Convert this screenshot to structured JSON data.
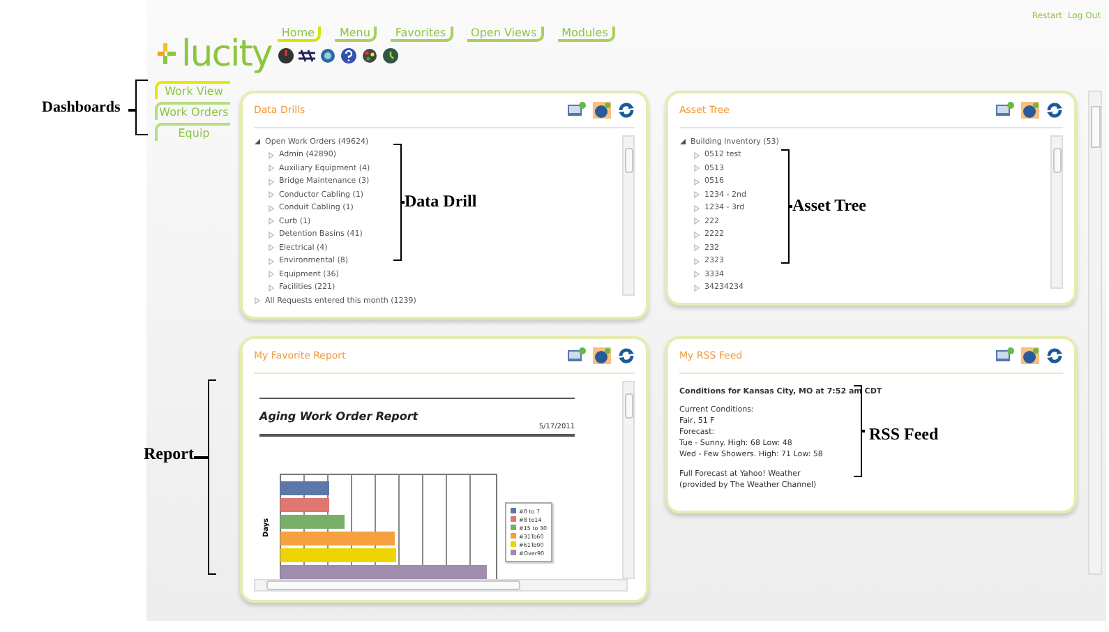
{
  "header": {
    "links": [
      {
        "label": "Restart"
      },
      {
        "label": "Log Out"
      }
    ],
    "logo": "lucity",
    "nav": [
      {
        "label": "Home",
        "selected": true
      },
      {
        "label": "Menu",
        "selected": false
      },
      {
        "label": "Favorites",
        "selected": false
      },
      {
        "label": "Open Views",
        "selected": false
      },
      {
        "label": "Modules",
        "selected": false
      }
    ]
  },
  "dashboards": [
    {
      "label": "Work View",
      "selected": true
    },
    {
      "label": "Work Orders",
      "selected": false
    },
    {
      "label": "Equip",
      "selected": false
    }
  ],
  "panels": [
    {
      "kind": "tree",
      "title": "Data Drills",
      "callout": "Data Drill",
      "tree": [
        {
          "label": "Open Work Orders (49624)",
          "expanded": true,
          "children": [
            {
              "label": "Admin (42890)",
              "expanded": false
            },
            {
              "label": "Auxiliary Equipment (4)",
              "expanded": false
            },
            {
              "label": "Bridge Maintenance (3)",
              "expanded": false
            },
            {
              "label": "Conductor Cabling (1)",
              "expanded": false
            },
            {
              "label": "Conduit Cabling (1)",
              "expanded": false
            },
            {
              "label": "Curb (1)",
              "expanded": false
            },
            {
              "label": "Detention Basins (41)",
              "expanded": false
            },
            {
              "label": "Electrical (4)",
              "expanded": false
            },
            {
              "label": "Environmental (8)",
              "expanded": false
            },
            {
              "label": "Equipment (36)",
              "expanded": false
            },
            {
              "label": "Facilities (221)",
              "expanded": false
            }
          ]
        },
        {
          "label": "All Requests entered this month (1239)",
          "expanded": false
        }
      ]
    },
    {
      "kind": "tree",
      "title": "Asset Tree",
      "callout": "Asset Tree",
      "tree": [
        {
          "label": "Building Inventory (53)",
          "expanded": true,
          "children": [
            {
              "label": "0512 test",
              "expanded": false
            },
            {
              "label": "0513",
              "expanded": false
            },
            {
              "label": "0516",
              "expanded": false
            },
            {
              "label": "1234 - 2nd",
              "expanded": false
            },
            {
              "label": "1234 - 3rd",
              "expanded": false
            },
            {
              "label": "222",
              "expanded": false
            },
            {
              "label": "2222",
              "expanded": false
            },
            {
              "label": "232",
              "expanded": false
            },
            {
              "label": "2323",
              "expanded": false
            },
            {
              "label": "3334",
              "expanded": false
            },
            {
              "label": "34234234",
              "expanded": false
            }
          ]
        }
      ]
    },
    {
      "kind": "report",
      "title": "My Favorite Report",
      "callout": "Report",
      "report_title": "Aging Work Order Report",
      "date": "5/17/2011",
      "axis_label": "Days",
      "legend": [
        {
          "label": "#0 to 7",
          "color": "#5b78a8"
        },
        {
          "label": "#8 to14",
          "color": "#e07872"
        },
        {
          "label": "#15 to 30",
          "color": "#78b06a"
        },
        {
          "label": "#31To60",
          "color": "#f7a040"
        },
        {
          "label": "#61To90",
          "color": "#eed400"
        },
        {
          "label": "#Over90",
          "color": "#a08cac"
        }
      ]
    },
    {
      "kind": "rss",
      "title": "My RSS Feed",
      "callout": "RSS Feed",
      "heading": "Conditions for Kansas City, MO at 7:52 am CDT",
      "paragraphs": [
        [
          "Current Conditions:",
          "Fair, 51 F",
          "Forecast:",
          "Tue - Sunny. High: 68 Low: 48",
          "Wed - Few Showers. High: 71 Low: 58"
        ],
        [
          "Full Forecast at Yahoo! Weather",
          "(provided by The Weather Channel)"
        ]
      ]
    }
  ],
  "dashboards_callout": "Dashboards"
}
